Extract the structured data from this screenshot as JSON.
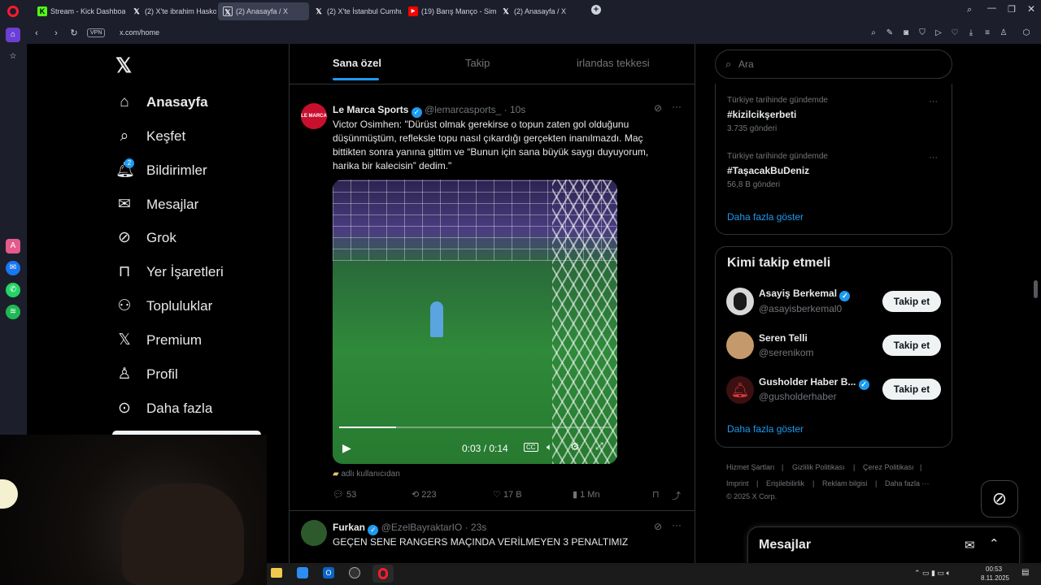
{
  "browser": {
    "tabs": [
      {
        "title": "Stream - Kick Dashboard",
        "icon": "kick-icon"
      },
      {
        "title": "(2) X'te ibrahim Haskoloğl",
        "icon": "x-logo-icon"
      },
      {
        "title": "(2) Anasayfa / X",
        "icon": "x-logo-icon",
        "active": true
      },
      {
        "title": "(2) X'te İstanbul Cumhuriy",
        "icon": "x-logo-icon"
      },
      {
        "title": "(19) Barış Manço - Simsiya",
        "icon": "youtube-icon"
      },
      {
        "title": "(2) Anasayfa / X",
        "icon": "x-logo-icon"
      }
    ],
    "vpn_label": "VPN",
    "url": "x.com/home"
  },
  "nav": {
    "items": [
      {
        "label": "Anasayfa",
        "icon": "home-icon"
      },
      {
        "label": "Keşfet",
        "icon": "search-icon"
      },
      {
        "label": "Bildirimler",
        "icon": "bell-icon",
        "badge": "2"
      },
      {
        "label": "Mesajlar",
        "icon": "mail-icon"
      },
      {
        "label": "Grok",
        "icon": "grok-icon"
      },
      {
        "label": "Yer İşaretleri",
        "icon": "bookmark-icon"
      },
      {
        "label": "Topluluklar",
        "icon": "communities-icon"
      },
      {
        "label": "Premium",
        "icon": "x-premium-icon"
      },
      {
        "label": "Profil",
        "icon": "profile-icon"
      },
      {
        "label": "Daha fazla",
        "icon": "more-circle-icon"
      }
    ]
  },
  "feed": {
    "tabs": [
      "Sana özel",
      "Takip",
      "irlandas tekkesi"
    ],
    "post1": {
      "avatar_text": "LE MARCA",
      "name": "Le Marca Sports",
      "handle": "@lemarcasports_",
      "time": "· 10s",
      "text": "Victor Osimhen: \"Dürüst olmak gerekirse o topun zaten gol olduğunu düşünmüştüm, refleksle topu nasıl çıkardığı gerçekten inanılmazdı. Maç bittikten sonra yanına gittim ve “Bunun için sana büyük saygı duyuyorum, harika bir kalecisin” dedim.\"",
      "video_time": "0:03 / 0:14",
      "video_progress": 0.21,
      "caption": "adlı kullanıcıdan",
      "replies": "53",
      "reposts": "223",
      "likes": "17 B",
      "views": "1 Mn"
    },
    "post2": {
      "name": "Furkan",
      "handle": "@EzelBayraktarIO",
      "time": "· 23s",
      "text": "GEÇEN SENE RANGERS MAÇINDA VERİLMEYEN 3 PENALTIMIZ"
    }
  },
  "right": {
    "search_placeholder": "Ara",
    "trends": [
      {
        "context": "Türkiye tarihinde gündemde",
        "tag": "#kizilcikşerbeti",
        "count": "3.735 gönderi"
      },
      {
        "context": "Türkiye tarihinde gündemde",
        "tag": "#TaşacakBuDeniz",
        "count": "56,8 B gönderi"
      }
    ],
    "trends_more": "Daha fazla göster",
    "who_title": "Kimi takip etmeli",
    "who": [
      {
        "name": "Asayiş Berkemal",
        "handle": "@asayisberkemal0",
        "verified": true,
        "button": "Takip et"
      },
      {
        "name": "Seren Telli",
        "handle": "@serenikom",
        "verified": false,
        "button": "Takip et"
      },
      {
        "name": "Gusholder Haber B...",
        "handle": "@gusholderhaber",
        "verified": true,
        "button": "Takip et"
      }
    ],
    "who_more": "Daha fazla göster",
    "footer": [
      "Hizmet Şartları",
      "Gizlilik Politikası",
      "Çerez Politikası",
      "Imprint",
      "Erişilebilirlik",
      "Reklam bilgisi",
      "Daha fazla ···",
      "© 2025 X Corp."
    ],
    "messages_title": "Mesajlar"
  },
  "taskbar": {
    "time": "00:53",
    "date": "8.11.2025"
  },
  "colors": {
    "accent": "#1d9bf0",
    "bg": "#000000",
    "border": "#2f3336",
    "muted": "#71767b"
  }
}
